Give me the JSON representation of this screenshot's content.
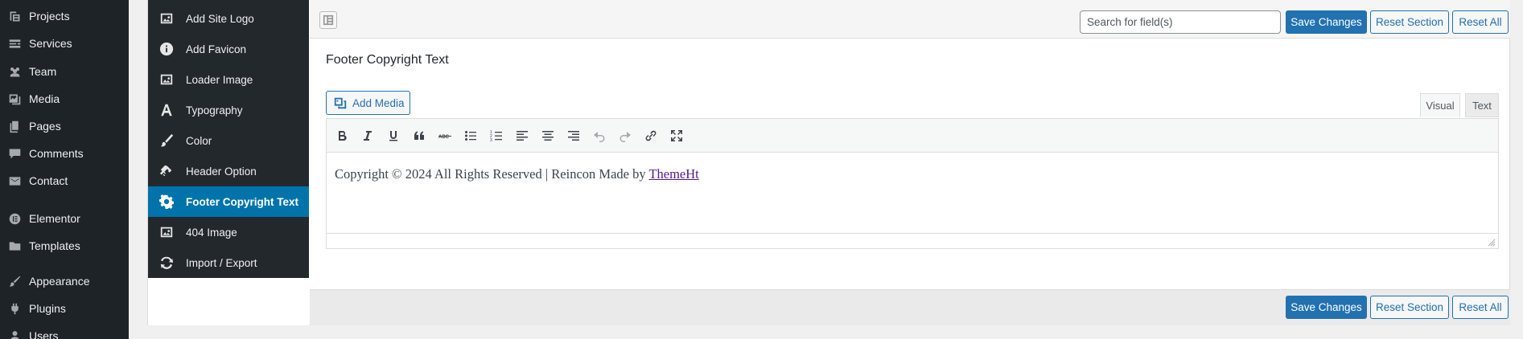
{
  "wp_menu": [
    {
      "label": "Projects",
      "icon": "projects-icon"
    },
    {
      "label": "Services",
      "icon": "services-icon"
    },
    {
      "label": "Team",
      "icon": "team-icon"
    },
    {
      "label": "Media",
      "icon": "media-icon"
    },
    {
      "label": "Pages",
      "icon": "pages-icon"
    },
    {
      "label": "Comments",
      "icon": "comments-icon"
    },
    {
      "label": "Contact",
      "icon": "envelope-icon"
    },
    {
      "label": "Elementor",
      "icon": "elementor-icon"
    },
    {
      "label": "Templates",
      "icon": "folder-icon"
    },
    {
      "label": "Appearance",
      "icon": "paintbrush-icon"
    },
    {
      "label": "Plugins",
      "icon": "plugin-icon"
    },
    {
      "label": "Users",
      "icon": "users-icon"
    }
  ],
  "options_nav": [
    {
      "label": "Add Site Logo",
      "icon": "image-icon"
    },
    {
      "label": "Add Favicon",
      "icon": "info-icon"
    },
    {
      "label": "Loader Image",
      "icon": "image-icon"
    },
    {
      "label": "Typography",
      "icon": "font-icon"
    },
    {
      "label": "Color",
      "icon": "brush-icon"
    },
    {
      "label": "Header Option",
      "icon": "link-icon"
    },
    {
      "label": "Footer Copyright Text",
      "icon": "gear-icon",
      "active": true
    },
    {
      "label": "404 Image",
      "icon": "image-icon"
    },
    {
      "label": "Import / Export",
      "icon": "refresh-icon"
    }
  ],
  "topbar": {
    "search_placeholder": "Search for field(s)",
    "save_label": "Save Changes",
    "reset_section_label": "Reset Section",
    "reset_all_label": "Reset All"
  },
  "section": {
    "title": "Footer Copyright Text",
    "add_media_label": "Add Media",
    "tab_visual": "Visual",
    "tab_text": "Text",
    "content_text": "Copyright © 2024 All Rights Reserved | Reincon Made by ",
    "content_link": "ThemeHt"
  },
  "toolbar_buttons": [
    "bold",
    "italic",
    "underline",
    "blockquote",
    "strikethrough",
    "bulleted-list",
    "numbered-list",
    "align-left",
    "align-center",
    "align-right",
    "undo",
    "redo",
    "insert-link",
    "fullscreen"
  ],
  "bottombar": {
    "save_label": "Save Changes",
    "reset_section_label": "Reset Section",
    "reset_all_label": "Reset All"
  },
  "colors": {
    "wp_sidebar": "#1d2327",
    "options_sidebar": "#23282d",
    "active_item": "#0073aa",
    "primary_button": "#2271b1"
  }
}
